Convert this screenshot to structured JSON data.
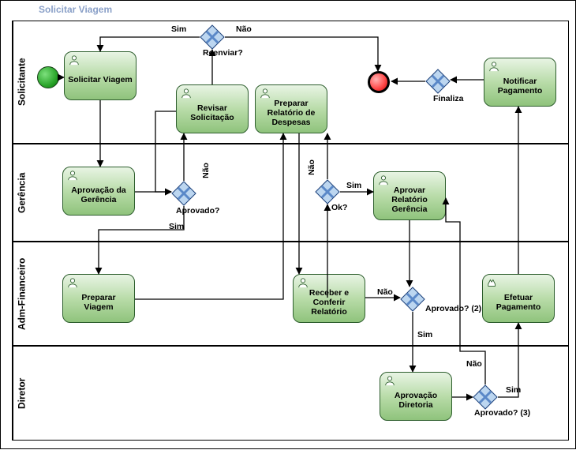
{
  "diagram_title": "Solicitar Viagem",
  "lanes": {
    "solicitante": "Solicitante",
    "gerencia": "Gerência",
    "adm_financeiro": "Adm-Financeiro",
    "diretor": "Diretor"
  },
  "tasks": {
    "solicitar_viagem": "Solicitar Viagem",
    "revisar_solicitacao": "Revisar Solicitação",
    "preparar_relatorio": "Preparar Relatório de Despesas",
    "notificar_pagamento": "Notificar Pagamento",
    "aprovacao_gerencia": "Aprovação da Gerência",
    "aprovar_rel_gerencia": "Aprovar Relatório Gerência",
    "preparar_viagem": "Preparar Viagem",
    "receber_conferir": "Receber e Conferir Relatório",
    "efetuar_pagamento": "Efetuar Pagamento",
    "aprovacao_diretoria": "Aprovação Diretoria"
  },
  "gateways": {
    "reenviar": "Reenviar?",
    "finaliza": "Finaliza",
    "aprovado": "Aprovado?",
    "ok": "Ok?",
    "aprovado2": "Aprovado? (2)",
    "aprovado3": "Aprovado? (3)"
  },
  "labels": {
    "sim": "Sim",
    "nao": "Não"
  }
}
